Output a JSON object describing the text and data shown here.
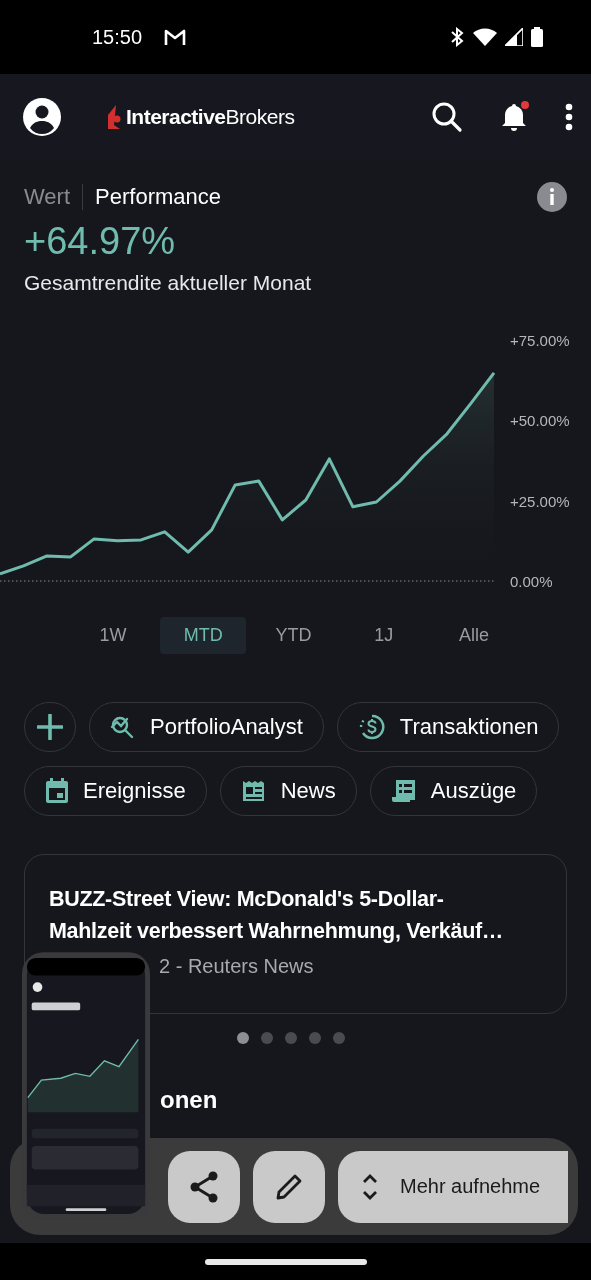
{
  "status_bar": {
    "time": "15:50"
  },
  "header": {
    "logo_bold": "Interactive",
    "logo_light": "Brokers",
    "notification_badge": true
  },
  "view_tabs": [
    {
      "label": "Wert",
      "selected": false
    },
    {
      "label": "Performance",
      "selected": true
    }
  ],
  "performance": {
    "value": "+64.97%",
    "caption": "Gesamtrendite aktueller Monat"
  },
  "chart_data": {
    "type": "area",
    "ylim": [
      0,
      75
    ],
    "yticks": [
      {
        "value": 75,
        "label": "+75.00%"
      },
      {
        "value": 50,
        "label": "+50.00%"
      },
      {
        "value": 25,
        "label": "+25.00%"
      },
      {
        "value": 0,
        "label": "0.00%"
      }
    ],
    "series": [
      {
        "color": "#6fbcae",
        "values": [
          2.2,
          4.7,
          7.8,
          7.5,
          13.1,
          12.5,
          12.8,
          15.3,
          9.0,
          15.9,
          29.9,
          31.1,
          19.0,
          25.2,
          38.0,
          23.1,
          24.6,
          31.1,
          38.9,
          45.8,
          55.1,
          64.8
        ]
      }
    ]
  },
  "periods": [
    {
      "label": "1W",
      "selected": false
    },
    {
      "label": "MTD",
      "selected": true
    },
    {
      "label": "YTD",
      "selected": false
    },
    {
      "label": "1J",
      "selected": false
    },
    {
      "label": "Alle",
      "selected": false
    }
  ],
  "shortcut_rows": [
    [
      {
        "kind": "add"
      },
      {
        "kind": "chip",
        "label": "PortfolioAnalyst"
      },
      {
        "kind": "chip",
        "label": "Transaktionen"
      }
    ],
    [
      {
        "kind": "chip",
        "label": "Ereignisse"
      },
      {
        "kind": "chip",
        "label": "News"
      },
      {
        "kind": "chip",
        "label": "Auszüge"
      }
    ]
  ],
  "news": {
    "title": "BUZZ-Street View: McDonald's 5-Dollar-Mahlzeit verbessert Wahrnehmung, Verkäuf…",
    "meta": "2 - Reuters News",
    "pages": [
      {
        "selected": true
      },
      {
        "selected": false
      },
      {
        "selected": false
      },
      {
        "selected": false
      },
      {
        "selected": false
      }
    ]
  },
  "section": {
    "title": "onen"
  },
  "screenshot_toolbar": {
    "capture_label": "Mehr aufnehme"
  }
}
